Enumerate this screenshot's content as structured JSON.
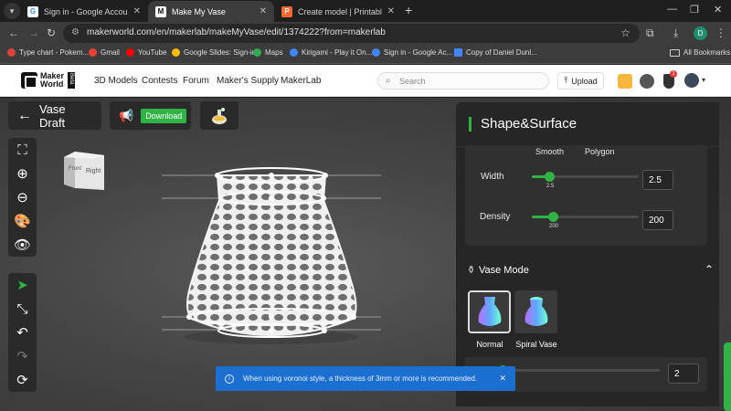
{
  "browser": {
    "tabs": [
      {
        "label": "Sign in - Google Accounts",
        "favicon": "google-g-icon",
        "active": false
      },
      {
        "label": "Make My Vase",
        "favicon": "makerworld-icon",
        "active": true
      },
      {
        "label": "Create model | Printables.com",
        "favicon": "printables-icon",
        "active": false
      }
    ],
    "new_tab_symbol": "+",
    "url": "makerworld.com/en/makerlab/makeMyVase/edit/1374222?from=makerlab",
    "bookmarks": [
      {
        "label": "Type chart - Pokem...",
        "color": "#db4437"
      },
      {
        "label": "Gmail",
        "color": "#ea4335"
      },
      {
        "label": "YouTube",
        "color": "#ff0000"
      },
      {
        "label": "Google Slides: Sign-in",
        "color": "#fbbc04"
      },
      {
        "label": "Maps",
        "color": "#34a853"
      },
      {
        "label": "Kirigami - Play it On...",
        "color": "#4285f4"
      },
      {
        "label": "Sign in - Google Ac...",
        "color": "#4285f4"
      },
      {
        "label": "Copy of Daniel Dunl...",
        "color": "#4285f4"
      }
    ],
    "all_bookmarks": "All Bookmarks",
    "profile_initial": "D"
  },
  "site": {
    "logo_line1": "Maker",
    "logo_line2": "World",
    "logo_tag": "Beta",
    "nav": [
      "3D Models",
      "Contests",
      "Forum",
      "Maker's Supply",
      "MakerLab"
    ],
    "search_placeholder": "Search",
    "upload_label": "Upload",
    "notification_count": "1"
  },
  "editor": {
    "back_label": "Vase Draft",
    "download_label": "Download",
    "view_cube": {
      "front": "Front",
      "right": "Right"
    },
    "tools_top": [
      "view-fit-icon",
      "zoom-in-icon",
      "zoom-out-icon",
      "palette-icon",
      "eye-icon"
    ],
    "tools_bottom": [
      "select-arrow-icon",
      "scale-icon",
      "undo-icon",
      "redo-icon",
      "refresh-icon"
    ]
  },
  "panel": {
    "title": "Shape&Surface",
    "style_smooth": "Smooth",
    "style_polygon": "Polygon",
    "width": {
      "label": "Width",
      "value": "2.5",
      "tick": "2.5",
      "fraction": 0.16
    },
    "density": {
      "label": "Density",
      "value": "200",
      "tick": "200",
      "fraction": 0.2
    },
    "vase_mode": {
      "title": "Vase Mode",
      "options": [
        {
          "label": "Normal",
          "selected": true
        },
        {
          "label": "Spiral Vase",
          "selected": false
        }
      ]
    },
    "thickness": {
      "value": "2",
      "fraction": 0.16
    }
  },
  "toast": {
    "message": "When using voronoi style, a thickness of 3mm or more is recommended."
  },
  "colors": {
    "accent_green": "#2fb344",
    "toast_blue": "#1b6fd1"
  }
}
